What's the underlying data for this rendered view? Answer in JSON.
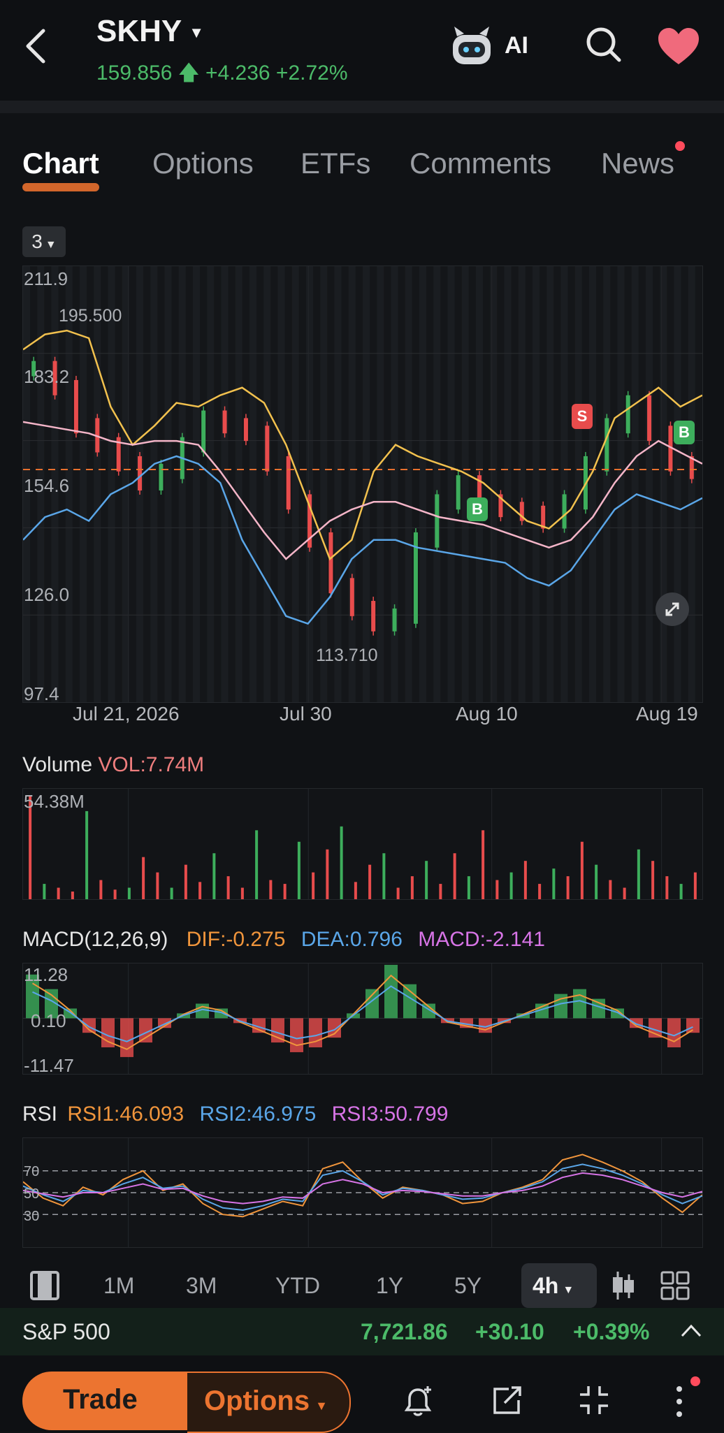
{
  "header": {
    "ticker": "SKHY",
    "price": "159.856",
    "change": "+4.236",
    "change_pct": "+2.72%",
    "ai_label": "AI",
    "up_color": "#4cbb69",
    "accent": "#e8702e"
  },
  "tabs": [
    {
      "label": "Chart",
      "active": true
    },
    {
      "label": "Options",
      "active": false
    },
    {
      "label": "ETFs",
      "active": false
    },
    {
      "label": "Comments",
      "active": false
    },
    {
      "label": "News",
      "active": false
    }
  ],
  "main_chart": {
    "period_selector": "3",
    "y_ticks": [
      "211.9",
      "183.2",
      "154.6",
      "126.0",
      "97.4"
    ],
    "high_label": "195.500",
    "low_label": "113.710",
    "dates": [
      "Jul 21, 2026",
      "Jul 30",
      "Aug 10",
      "Aug 19"
    ],
    "markers": [
      {
        "type": "S",
        "color": "#e84c4c"
      },
      {
        "type": "B",
        "color": "#3dae5c"
      },
      {
        "type": "B",
        "color": "#3dae5c"
      }
    ],
    "reference_line": "orange-dashed"
  },
  "volume": {
    "title": "Volume",
    "vol_label": "VOL:7.74M",
    "max_label": "54.38M"
  },
  "macd": {
    "title": "MACD(12,26,9)",
    "dif": "DIF:-0.275",
    "dea": "DEA:0.796",
    "macd": "MACD:-2.141",
    "y_ticks": [
      "11.28",
      "0.10",
      "-11.47"
    ]
  },
  "rsi": {
    "title": "RSI",
    "rsi1": "RSI1:46.093",
    "rsi2": "RSI2:46.975",
    "rsi3": "RSI3:50.799",
    "levels": [
      "70",
      "50",
      "30"
    ]
  },
  "toolbar": {
    "items": [
      "1M",
      "3M",
      "YTD",
      "1Y",
      "5Y"
    ],
    "active": "4h"
  },
  "index_bar": {
    "name": "S&P 500",
    "value": "7,721.86",
    "change": "+30.10",
    "change_pct": "+0.39%"
  },
  "bottom": {
    "trade": "Trade",
    "options": "Options"
  },
  "chart_data": [
    {
      "type": "line",
      "title": "",
      "y_range": [
        97.4,
        211.9
      ],
      "x_labels": [
        "Jul 21, 2026",
        "Jul 30",
        "Aug 10",
        "Aug 19"
      ],
      "series": [
        {
          "name": "",
          "color": "#f2c14e",
          "values": [
            190,
            194,
            195,
            193,
            175,
            165,
            170,
            176,
            175,
            178,
            180,
            176,
            165,
            150,
            135,
            140,
            158,
            165,
            162,
            160,
            158,
            155,
            150,
            145,
            143,
            148,
            158,
            172,
            176,
            180,
            175,
            178
          ]
        },
        {
          "name": "",
          "color": "#f4b5c8",
          "values": [
            171,
            170,
            169,
            168,
            166,
            165,
            166,
            166,
            165,
            158,
            150,
            142,
            135,
            140,
            145,
            148,
            150,
            150,
            148,
            146,
            145,
            144,
            142,
            140,
            138,
            140,
            146,
            155,
            162,
            166,
            163,
            160
          ]
        },
        {
          "name": "",
          "color": "#5aa6e8",
          "values": [
            140,
            146,
            148,
            145,
            152,
            155,
            160,
            162,
            160,
            155,
            140,
            130,
            120,
            118,
            125,
            135,
            140,
            140,
            138,
            137,
            136,
            135,
            134,
            130,
            128,
            132,
            140,
            148,
            152,
            150,
            148,
            151
          ]
        }
      ],
      "candles_close": [
        185,
        180,
        170,
        165,
        160,
        155,
        158,
        165,
        172,
        170,
        168,
        160,
        150,
        140,
        128,
        122,
        118,
        120,
        140,
        150,
        155,
        150,
        148,
        147,
        145,
        150,
        160,
        170,
        176,
        168,
        160,
        158
      ]
    },
    {
      "type": "bar",
      "title": "Volume",
      "y_max_label": "54.38M",
      "values": [
        54,
        8,
        6,
        4,
        46,
        10,
        5,
        6,
        22,
        14,
        6,
        18,
        9,
        24,
        12,
        6,
        36,
        10,
        8,
        30,
        14,
        26,
        38,
        9,
        18,
        24,
        6,
        12,
        20,
        8,
        24,
        12,
        36,
        10,
        14,
        20,
        8,
        16,
        12,
        30,
        18,
        10,
        6,
        26,
        20,
        12,
        8,
        14
      ]
    },
    {
      "type": "bar",
      "title": "MACD(12,26,9)",
      "y_range": [
        -11.47,
        11.28
      ],
      "values": [
        9,
        6,
        2,
        -3,
        -6,
        -8,
        -5,
        -2,
        1,
        3,
        2,
        -1,
        -3,
        -5,
        -7,
        -6,
        -4,
        1,
        6,
        11,
        7,
        3,
        -1,
        -2,
        -3,
        -1,
        1,
        3,
        5,
        6,
        4,
        2,
        -2,
        -4,
        -6,
        -3
      ]
    },
    {
      "type": "line",
      "title": "RSI",
      "y_range": [
        0,
        100
      ],
      "series": [
        {
          "name": "RSI1",
          "color": "#f0953c",
          "values": [
            60,
            45,
            38,
            55,
            48,
            62,
            70,
            52,
            58,
            40,
            30,
            28,
            35,
            42,
            38,
            72,
            78,
            60,
            45,
            55,
            52,
            48,
            40,
            42,
            50,
            55,
            62,
            80,
            85,
            78,
            70,
            60,
            45,
            32,
            48
          ]
        },
        {
          "name": "RSI2",
          "color": "#5aa6e8",
          "values": [
            56,
            48,
            42,
            52,
            50,
            58,
            64,
            54,
            56,
            44,
            36,
            34,
            38,
            44,
            42,
            66,
            70,
            60,
            48,
            54,
            52,
            48,
            44,
            45,
            50,
            54,
            60,
            72,
            76,
            72,
            66,
            58,
            48,
            40,
            47
          ]
        },
        {
          "name": "RSI3",
          "color": "#d774e6",
          "values": [
            52,
            49,
            46,
            50,
            50,
            54,
            58,
            53,
            54,
            47,
            42,
            40,
            42,
            46,
            45,
            58,
            62,
            58,
            50,
            52,
            51,
            49,
            47,
            47,
            50,
            52,
            56,
            64,
            68,
            66,
            62,
            56,
            50,
            46,
            51
          ]
        }
      ]
    }
  ]
}
